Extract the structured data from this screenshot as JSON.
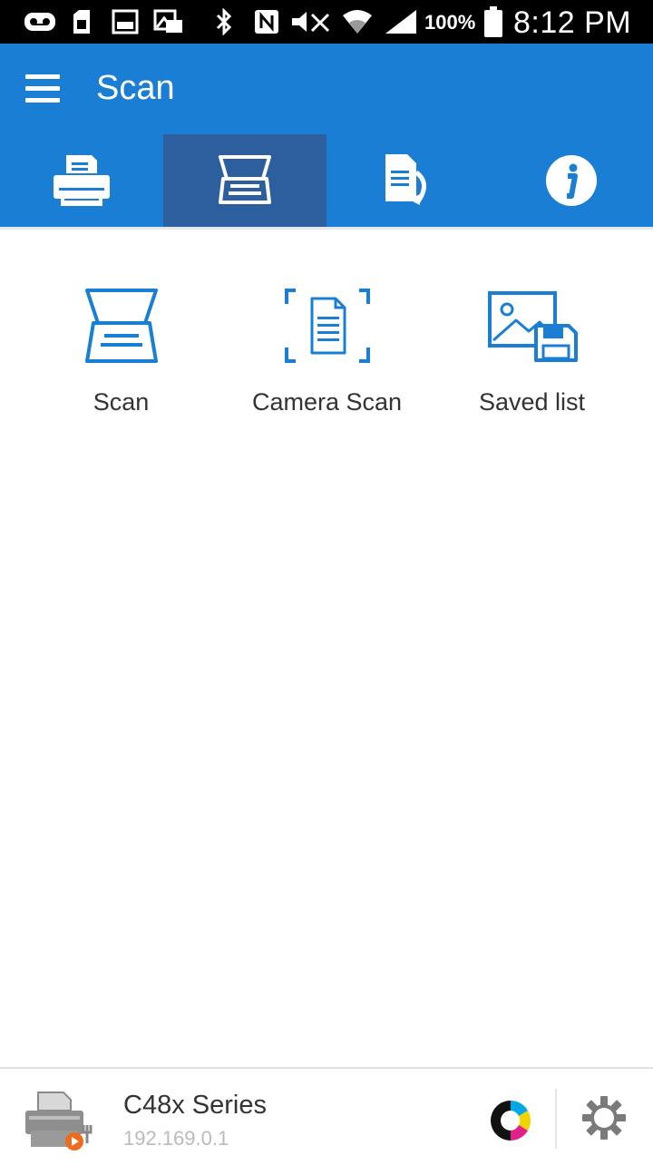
{
  "status_bar": {
    "battery_percent": "100%",
    "time": "8:12 PM",
    "icons": [
      "voicemail-icon",
      "sim-icon",
      "screenshot-icon",
      "photo-icon",
      "bluetooth-icon",
      "nfc-icon",
      "mute-icon",
      "wifi-icon",
      "signal-icon",
      "battery-icon"
    ]
  },
  "app_bar": {
    "title": "Scan",
    "menu_icon": "menu-icon"
  },
  "tabs": [
    {
      "icon": "printer-icon",
      "active": false
    },
    {
      "icon": "scanner-icon",
      "active": true
    },
    {
      "icon": "document-convert-icon",
      "active": false
    },
    {
      "icon": "info-icon",
      "active": false
    }
  ],
  "functions": [
    {
      "label": "Scan",
      "icon": "scanner-icon"
    },
    {
      "label": "Camera Scan",
      "icon": "camera-scan-icon"
    },
    {
      "label": "Saved list",
      "icon": "saved-list-icon"
    }
  ],
  "printer": {
    "name": "C48x Series",
    "ip": "192.169.0.1",
    "ink_icon": "ink-levels-icon",
    "settings_icon": "gear-icon"
  },
  "colors": {
    "accent": "#1a7fd4",
    "active_tab": "#2d5f9e",
    "icon_blue": "#1a7fd4"
  }
}
